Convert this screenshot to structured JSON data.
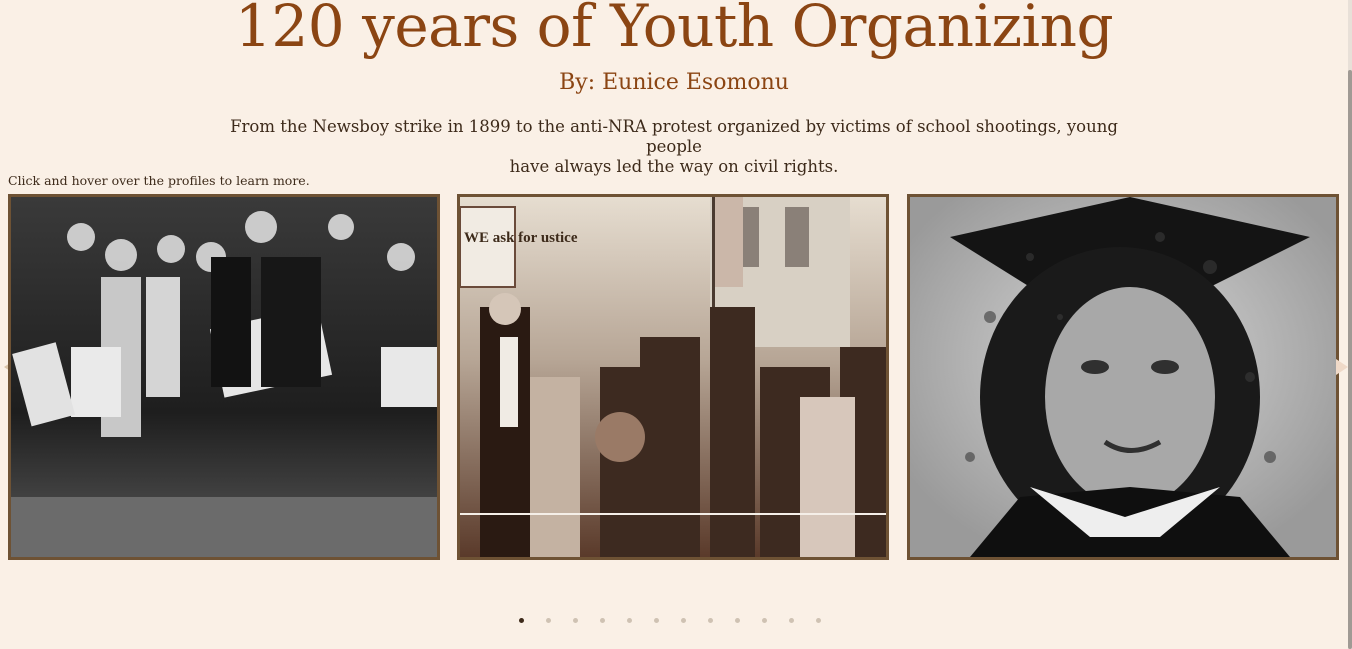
{
  "header": {
    "title": "120 years of Youth Organizing",
    "byline": "By: Eunice Esomonu",
    "intro_line1": "From the Newsboy strike in 1899 to the anti-NRA protest organized by victims of school shootings, young people",
    "intro_line2": "have always led the way on civil rights."
  },
  "hint": "Click and hover over the profiles to learn more.",
  "carousel": {
    "cards": [
      {
        "name": "newsboys-photo"
      },
      {
        "name": "march-photo",
        "sign_text": "WE ask for ustice"
      },
      {
        "name": "graduate-portrait"
      }
    ],
    "dots_count": 12,
    "active_dot": 0
  },
  "colors": {
    "background": "#faf0e6",
    "accent": "#8b4513",
    "border": "#6e5234",
    "text": "#3d2a1a"
  }
}
